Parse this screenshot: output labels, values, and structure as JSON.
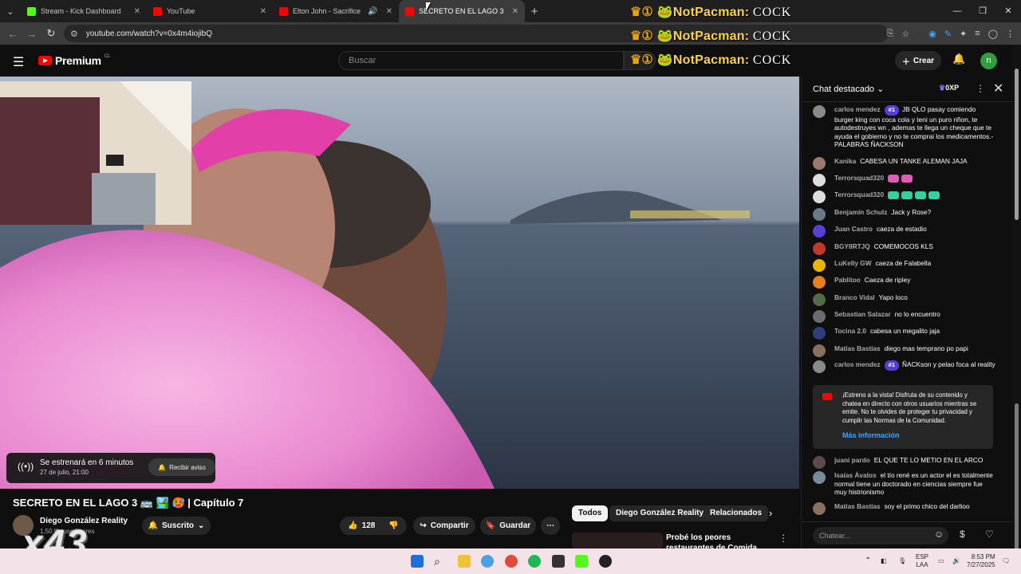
{
  "browser": {
    "tabs": [
      {
        "title": "Stream - Kick Dashboard",
        "favicon_color": "#53fc18",
        "active": false
      },
      {
        "title": "YouTube",
        "favicon_color": "#ff0000",
        "active": false
      },
      {
        "title": "Elton John - Sacrifice - You",
        "favicon_color": "#ff0000",
        "active": false
      },
      {
        "title": "SECRETO EN EL LAGO 3",
        "favicon_color": "#ff0000",
        "active": true
      }
    ],
    "new_tab_label": "+",
    "url": "youtube.com/watch?v=0x4m4iojibQ"
  },
  "stream_overlay": {
    "name": "NotPacman:",
    "suffix": "COCK",
    "crown_icon": "crown-one-icon"
  },
  "youtube": {
    "logo_text": "Premium",
    "logo_region": "CL",
    "search_placeholder": "Buscar",
    "create_label": "Crear",
    "avatar_letter": "n"
  },
  "video": {
    "premiere_line1": "Se estrenará en 6 minutos",
    "premiere_line2": "27 de julio, 21:00",
    "notify_label": "Recibir aviso",
    "title": "SECRETO EN EL LAGO 3 🚌 🏞️ 🥵 | Capítulo 7",
    "channel": "Diego González Reality",
    "subscribers": "1,50 K suscriptores",
    "subscribed_label": "Suscrito",
    "likes": "128",
    "share_label": "Compartir",
    "save_label": "Guardar",
    "overlay_multiplier": "x43"
  },
  "chips": [
    "Todos",
    "Diego González Reality",
    "Relacionados"
  ],
  "recommendation": {
    "title": "Probé los peores restaurantes de Comida Rápida del Mundo"
  },
  "chat": {
    "header": "Chat destacado",
    "xp_badge": "0XP",
    "messages": [
      {
        "author": "carlos mendez",
        "badge": "#1",
        "text": "JB QLO pasay comiendo burger king con coca cola y teni un puro riñon, te autodestruyes wn , ademas te llega un cheque que te ayuda el gobierno y no te comprai los medicamentos.- PALABRAS ÑACKSON",
        "avatar_color": "#8a8a8a"
      },
      {
        "author": "Kanika",
        "badge": "",
        "text": "CABESA UN TANKE ALEMAN JAJA",
        "avatar_color": "#9a7a6a"
      },
      {
        "author": "Terrorsquad320",
        "badge": "",
        "text": "",
        "avatar_color": "#dddddd"
      },
      {
        "author": "Terrorsquad320",
        "badge": "",
        "text": "",
        "avatar_color": "#dddddd"
      },
      {
        "author": "Benjamín Schulz",
        "badge": "",
        "text": "Jack y Rose?",
        "avatar_color": "#6a7a8a"
      },
      {
        "author": "Juan Castro",
        "badge": "",
        "text": "caeza de estadio",
        "avatar_color": "#5b3fd1"
      },
      {
        "author": "BGY8RTJQ",
        "badge": "",
        "text": "COMEMOCOS KLS",
        "avatar_color": "#c0392b"
      },
      {
        "author": "LuKelly GW",
        "badge": "",
        "text": "caeza de Falabella",
        "avatar_color": "#e8b400"
      },
      {
        "author": "Pablitoo",
        "badge": "",
        "text": "Caeza de ripley",
        "avatar_color": "#e67e22"
      },
      {
        "author": "Branco Vidal",
        "badge": "",
        "text": "Yapo loco",
        "avatar_color": "#556b4a"
      },
      {
        "author": "Sebastian Salazar",
        "badge": "",
        "text": "no lo encuentro",
        "avatar_color": "#6d6d6d"
      },
      {
        "author": "Tocina 2.0",
        "badge": "",
        "text": "cabesa un megalito jaja",
        "avatar_color": "#2d3e7a"
      },
      {
        "author": "Matías Bastías",
        "badge": "",
        "text": "diego mas temprano po papi",
        "avatar_color": "#8a7060"
      },
      {
        "author": "carlos mendez",
        "badge": "#1",
        "text": "ÑACKson y pelao foca al reality",
        "avatar_color": "#8a8a8a"
      },
      {
        "author": "juani pardo",
        "badge": "",
        "text": "EL QUE TE LO METIO EN EL ARCO",
        "avatar_color": "#5a4a4a"
      },
      {
        "author": "Isaías Ávalos",
        "badge": "",
        "text": "el tío rené es un actor el es totalmente normal tiene un doctorado en ciencias siempre fue muy histrionismo",
        "avatar_color": "#7a8a9a"
      },
      {
        "author": "Matías Bastías",
        "badge": "",
        "text": "soy el primo chico del darlioo",
        "avatar_color": "#8a7060"
      }
    ],
    "info_text": "¡Estreno a la vista! Disfruta de su contenido y chatea en directo con otros usuarios mientras se emite. No te olvides de proteger tu privacidad y cumplir las Normas de la Comunidad.",
    "info_link": "Más información",
    "input_placeholder": "Chatear..."
  },
  "taskbar": {
    "lang_top": "ESP",
    "lang_bottom": "LAA",
    "time": "8:53 PM",
    "date": "7/27/2025"
  },
  "colors": {
    "accent": "#3ea6ff",
    "youtube_red": "#ff0000",
    "member_badge": "#5a3bd6"
  }
}
